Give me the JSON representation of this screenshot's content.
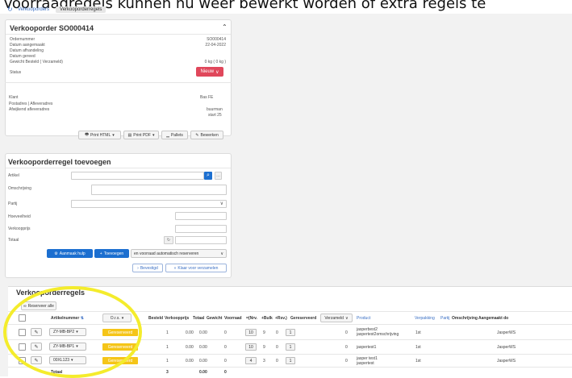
{
  "caption": "Voorraadregels kunnen nu weer bewerkt worden of extra regels te",
  "nav": {
    "refresh_icon": "refresh-icon",
    "breadcrumb": [
      "Verkooporders",
      "Verkooporderregels"
    ]
  },
  "order": {
    "title": "Verkooporder SO000414",
    "fields": [
      {
        "label": "Ordernummer",
        "value": "SO000414"
      },
      {
        "label": "Datum aangemaakt",
        "value": "22-04-2022"
      },
      {
        "label": "Datum afhandeling",
        "value": ""
      },
      {
        "label": "Datum gereed",
        "value": ""
      },
      {
        "label": "Gewicht Besteld ( Verzameld)",
        "value": "0 kg ( 0 kg )"
      }
    ],
    "status_label": "Status",
    "status_value": "Nieuw",
    "klant_label": "Klant",
    "klant_value": "Bas FE",
    "postadres_label": "Postadres | Afleveradres",
    "afwijkend_label": "Afwijkend afleveradres",
    "afwijkend_value_1": "buurman",
    "afwijkend_value_2": "start 25",
    "buttons": {
      "print_html": "Print HTML",
      "print_pdf": "Print PDF",
      "pallets": "Pallets",
      "bewerken": "Bewerken"
    }
  },
  "add_rule": {
    "title": "Verkooporderregel toevoegen",
    "labels": {
      "artikel": "Artikel",
      "omschrijving": "Omschrijving",
      "partij": "Partij",
      "hoeveelheid": "Hoeveelheid",
      "verkoopprijs": "Verkoopprijs",
      "totaal": "Totaal"
    },
    "buttons": {
      "aanmaak_hulp": "Aanmaak hulp",
      "toevoegen": "Toevoegen",
      "reserveren_option": "en voorraad automatisch reserveren",
      "bevestigd": "Bevestigd",
      "klaar": "Klaar voor verzamelen"
    }
  },
  "rules": {
    "title": "Verkooporderregels",
    "reserve_all": "Reserveer alle",
    "headers": {
      "artikelnummer": "Artikelnummer",
      "ors": "O.r.s.",
      "besteld": "Besteld",
      "verkoopprijs": "Verkoopprijs",
      "totaal": "Totaal",
      "gewicht": "Gewicht",
      "voorraad": "Voorraad",
      "nrv": "=(Nrv.",
      "bulk": "+Bulk",
      "rsv": "+Rsv.)",
      "gereserveerd": "Gereserveerd",
      "verzameld": "Verzameld",
      "product": "Product",
      "verpakking": "Verpakking",
      "partij": "Partij",
      "omschrijving": "Omschrijving",
      "aangemaakt": "Aangemaakt do"
    },
    "rows": [
      {
        "artikel": "ZY-MB-BP2",
        "ors": "Gereserveerd",
        "besteld": "1",
        "prijs": "0.00",
        "totaal": "0.00",
        "gewicht": "0",
        "voorraad": "10",
        "nrv": "9",
        "bulk": "0",
        "rsv": "1",
        "verzameld": "0",
        "product_1": "jasperbest2",
        "product_2": "jaspertest2omschrijving",
        "verpakking": "1st",
        "aangemaakt": "JasperWS"
      },
      {
        "artikel": "ZY-MB-BP1",
        "ors": "Gereserveerd",
        "besteld": "1",
        "prijs": "0.00",
        "totaal": "0.00",
        "gewicht": "0",
        "voorraad": "10",
        "nrv": "9",
        "bulk": "0",
        "rsv": "1",
        "verzameld": "0",
        "product_1": "jaspertest1",
        "product_2": "",
        "verpakking": "1st",
        "aangemaakt": "JasperWS"
      },
      {
        "artikel": "00XL123",
        "ors": "Gereserveerd",
        "besteld": "1",
        "prijs": "0.00",
        "totaal": "0.00",
        "gewicht": "0",
        "voorraad": "4",
        "nrv": "3",
        "bulk": "0",
        "rsv": "1",
        "verzameld": "0",
        "product_1": "jasper test1",
        "product_2": "jaspertest",
        "verpakking": "1st",
        "aangemaakt": "JasperWS"
      }
    ],
    "footer": {
      "label": "Totaal",
      "besteld": "3",
      "totaal": "0.00",
      "gewicht": "0"
    }
  },
  "colors": {
    "accent": "#1c6fd0",
    "status": "#e0475b",
    "badge": "#f5c518",
    "highlight": "#f4ec2c"
  }
}
